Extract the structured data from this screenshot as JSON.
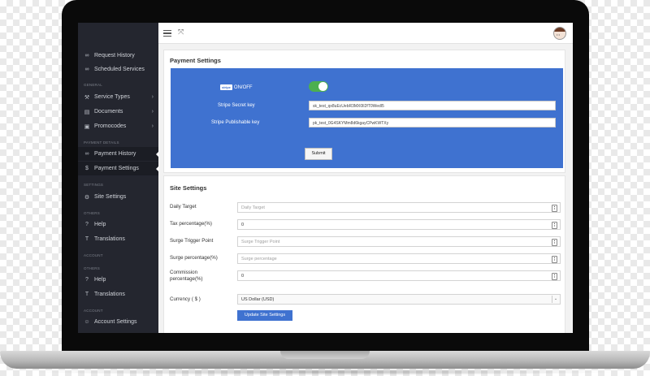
{
  "sidebar": {
    "top_items": [
      {
        "icon": "link-icon",
        "label": "Request History"
      },
      {
        "icon": "link-icon",
        "label": "Scheduled Services"
      }
    ],
    "sections": {
      "general": "GENERAL",
      "payment_details": "PAYMENT DETAILS",
      "settings": "SETTINGS",
      "others1": "OTHERS",
      "account1": "ACCOUNT",
      "others2": "OTHERS",
      "account2": "ACCOUNT"
    },
    "general_items": [
      {
        "icon": "wrench-icon",
        "label": "Service Types",
        "chevron": "›"
      },
      {
        "icon": "document-icon",
        "label": "Documents",
        "chevron": "›"
      },
      {
        "icon": "promo-icon",
        "label": "Promocodes",
        "chevron": "›"
      }
    ],
    "payment_items": [
      {
        "icon": "link-icon",
        "label": "Payment History"
      },
      {
        "icon": "dollar-icon",
        "label": "Payment Settings"
      }
    ],
    "settings_items": [
      {
        "icon": "gear-icon",
        "label": "Site Settings"
      }
    ],
    "others1_items": [
      {
        "icon": "help-icon",
        "label": "Help"
      },
      {
        "icon": "translate-icon",
        "label": "Translations"
      }
    ],
    "others2_items": [
      {
        "icon": "help-icon",
        "label": "Help"
      },
      {
        "icon": "translate-icon",
        "label": "Translations"
      }
    ],
    "account2_items": [
      {
        "icon": "user-icon",
        "label": "Account Settings"
      }
    ]
  },
  "payment": {
    "title": "Payment Settings",
    "stripe_logo": "stripe",
    "onoff_label": "ON/OFF",
    "toggle_on": true,
    "secret_label": "Stripe Secret key",
    "secret_value": "sk_test_qx8uEcUebR3MX0lI2fT0Wedl5",
    "publishable_label": "Stripe Publishable key",
    "publishable_value": "pk_test_0G4SKYMm8d6kgayCPwKWTXy",
    "submit_label": "Submit",
    "accent": "#3f72d0"
  },
  "site": {
    "title": "Site Settings",
    "daily_target_label": "Daily Target",
    "daily_target_placeholder": "Daily Target",
    "tax_label": "Tax percentage(%)",
    "tax_value": "0",
    "surge_trigger_label": "Surge Trigger Point",
    "surge_trigger_placeholder": "Surge Trigger Point",
    "surge_pct_label": "Surge percentage(%)",
    "surge_pct_placeholder": "Surge percentage",
    "commission_label_1": "Commission",
    "commission_label_2": "percentage(%)",
    "commission_value": "0",
    "currency_label": "Currency ( $ )",
    "currency_value": "US Dollar (USD)",
    "update_label": "Update Site Settings"
  }
}
